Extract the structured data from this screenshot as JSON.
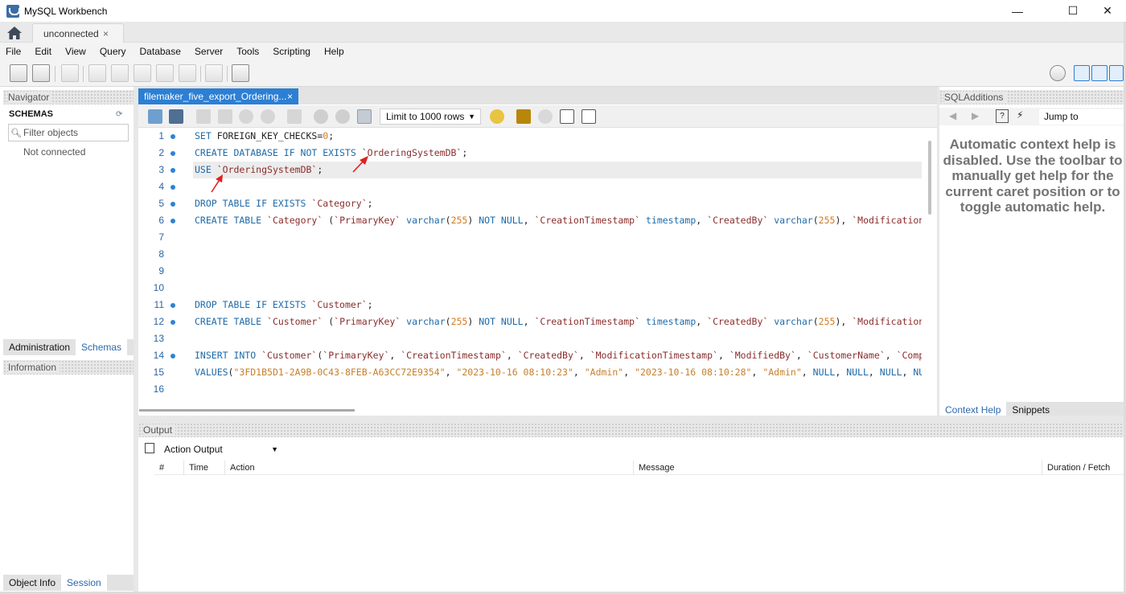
{
  "window": {
    "title": "MySQL Workbench",
    "minimize": "—",
    "maximize": "☐",
    "close": "✕"
  },
  "tabs": {
    "connection_tab": "unconnected",
    "close": "×"
  },
  "menu": [
    "File",
    "Edit",
    "View",
    "Query",
    "Database",
    "Server",
    "Tools",
    "Scripting",
    "Help"
  ],
  "navigator": {
    "header": "Navigator",
    "schemas_title": "SCHEMAS",
    "filter_placeholder": "Filter objects",
    "status": "Not connected",
    "tabs": [
      "Administration",
      "Schemas"
    ],
    "info_header": "Information",
    "bottom_tabs": [
      "Object Info",
      "Session"
    ]
  },
  "editor": {
    "tab_title": "filemaker_five_export_Ordering...",
    "tab_close": "×",
    "limit_rows": "Limit to 1000 rows",
    "line_numbers": [
      "1",
      "2",
      "3",
      "4",
      "5",
      "6",
      "7",
      "8",
      "9",
      "10",
      "11",
      "12",
      "13",
      "14",
      "15",
      "16"
    ]
  },
  "sql_additions": {
    "header": "SQLAdditions",
    "jump_to": "Jump to",
    "help_lines": [
      "Automatic context help is",
      "disabled. Use the toolbar to",
      "manually get help for the",
      "current caret position or to",
      "toggle automatic help."
    ],
    "tabs": [
      "Context Help",
      "Snippets"
    ]
  },
  "output": {
    "header": "Output",
    "selector": "Action Output",
    "columns": [
      "#",
      "Time",
      "Action",
      "Message",
      "Duration / Fetch"
    ]
  },
  "colors": {
    "accent": "#2c7fd4",
    "keyword": "#1e6aa8",
    "string": "#a34b27",
    "arrow": "#e02020"
  }
}
